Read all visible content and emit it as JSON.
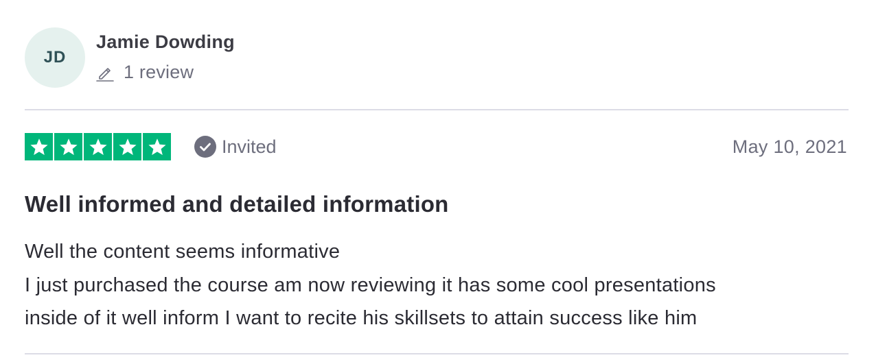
{
  "reviewer": {
    "initials": "JD",
    "name": "Jamie Dowding",
    "review_count": "1 review",
    "avatar_bg": "#e5f1ee"
  },
  "rating": {
    "stars": 5,
    "max_stars": 5,
    "star_color": "#00b67a",
    "invited_label": "Invited",
    "date": "May 10, 2021"
  },
  "review": {
    "title": "Well informed and detailed information",
    "body_lines": [
      "Well the content seems informative",
      "I just purchased the course am now reviewing it has some cool presentations",
      "inside of it well inform I want to recite his skillsets to attain success like him"
    ]
  }
}
